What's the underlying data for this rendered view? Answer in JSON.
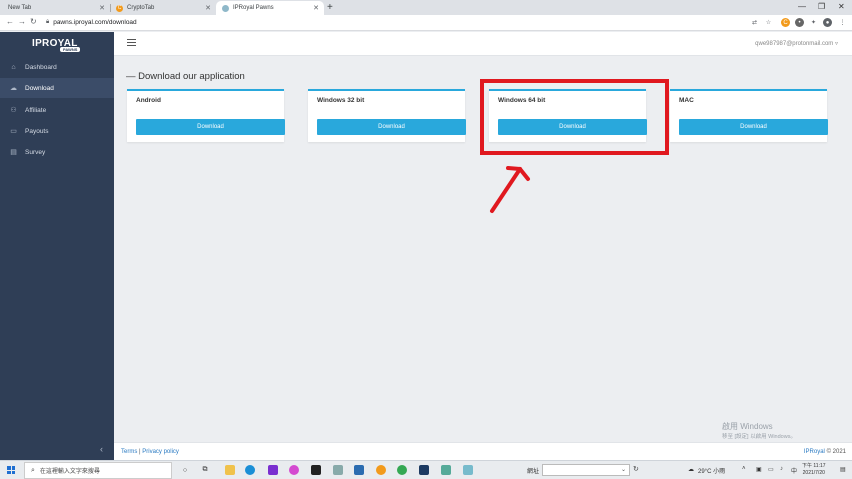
{
  "browser": {
    "tabs": [
      {
        "title": "New Tab"
      },
      {
        "title": "CryptoTab"
      },
      {
        "title": "IPRoyal Pawns"
      }
    ],
    "url": "pawns.iproyal.com/download"
  },
  "sidebar": {
    "logo_text": "IPROYAL",
    "logo_badge": "PAWNS",
    "items": [
      {
        "label": "Dashboard"
      },
      {
        "label": "Download"
      },
      {
        "label": "Affiliate"
      },
      {
        "label": "Payouts"
      },
      {
        "label": "Survey"
      }
    ],
    "collapse_icon": "chevron-left-icon"
  },
  "header": {
    "user_email": "qwe987987@protonmail.com"
  },
  "main": {
    "title": "— Download our application",
    "cards": [
      {
        "platform": "Android",
        "button": "Download"
      },
      {
        "platform": "Windows 32 bit",
        "button": "Download"
      },
      {
        "platform": "Windows 64 bit",
        "button": "Download"
      },
      {
        "platform": "MAC",
        "button": "Download"
      }
    ]
  },
  "footer": {
    "terms": "Terms",
    "separator": "|",
    "privacy": "Privacy policy",
    "brand": "IPRoyal",
    "copyright": "© 2021"
  },
  "watermark": {
    "line1": "啟用 Windows",
    "line2": "移至 [設定] 以啟用 Windows。"
  },
  "taskbar": {
    "search_placeholder": "在這裡輸入文字來搜尋",
    "address_label": "網址",
    "weather": "29°C 小雨",
    "time": "下午 11:17",
    "date": "2021/7/20"
  },
  "colors": {
    "accent": "#29a8dc",
    "sidebar": "#2f3e56",
    "highlight": "#e0181f"
  }
}
